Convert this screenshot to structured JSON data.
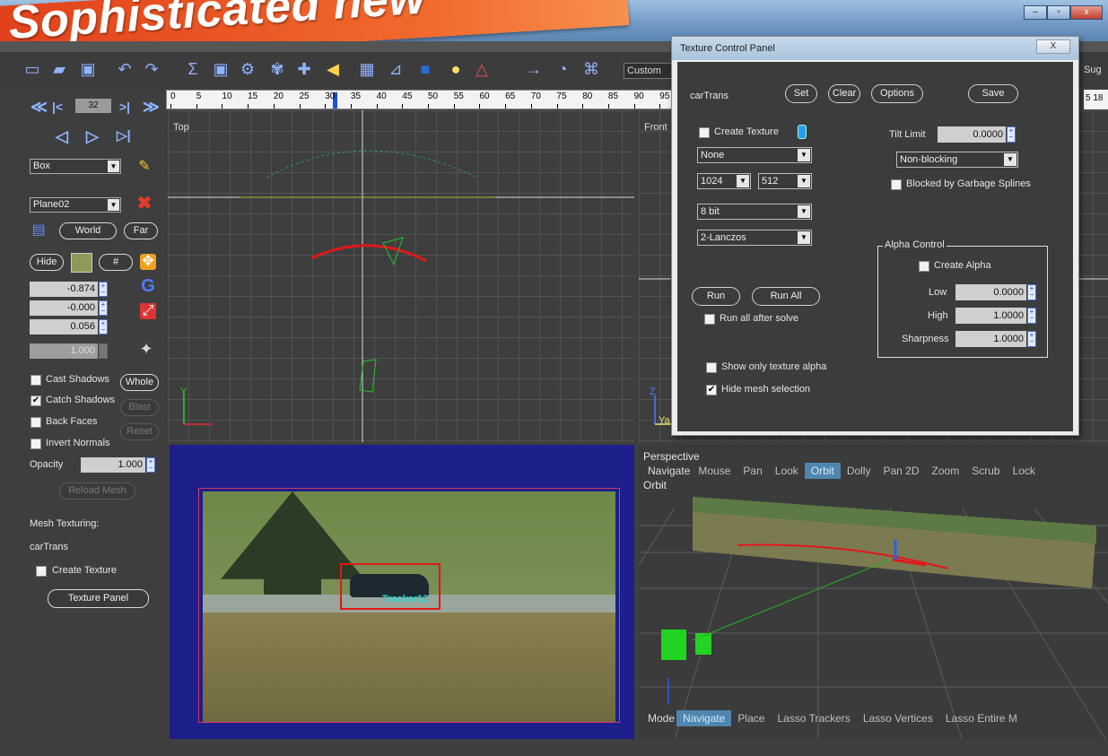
{
  "banner": {
    "text": "Sophisticated new"
  },
  "window": {
    "minimize": "–",
    "maximize": "▫",
    "close": "x"
  },
  "toolbar": {
    "icons": [
      {
        "name": "new-icon",
        "glyph": "▭",
        "color": "#8fb3ff"
      },
      {
        "name": "open-icon",
        "glyph": "▰",
        "color": "#8fb3ff"
      },
      {
        "name": "save-icon",
        "glyph": "▣",
        "color": "#8fb3ff"
      },
      {
        "name": "undo-icon",
        "glyph": "↶",
        "color": "#8fb3ff"
      },
      {
        "name": "redo-icon",
        "glyph": "↷",
        "color": "#8fb3ff"
      },
      {
        "name": "sigma-icon",
        "glyph": "Σ",
        "color": "#8fb3ff"
      },
      {
        "name": "camera-icon",
        "glyph": "▣",
        "color": "#8fb3ff"
      },
      {
        "name": "gear-icon",
        "glyph": "⚙",
        "color": "#8fb3ff"
      },
      {
        "name": "paw-icon",
        "glyph": "✾",
        "color": "#8fb3ff"
      },
      {
        "name": "move-icon",
        "glyph": "✚",
        "color": "#8fb3ff"
      },
      {
        "name": "audio-icon",
        "glyph": "◀",
        "color": "#ffd24a"
      },
      {
        "name": "calculator-icon",
        "glyph": "▦",
        "color": "#8fb3ff"
      },
      {
        "name": "graph-icon",
        "glyph": "⊿",
        "color": "#8fb3ff"
      },
      {
        "name": "cube-icon",
        "glyph": "■",
        "color": "#2a6bd6"
      },
      {
        "name": "light-icon",
        "glyph": "●",
        "color": "#ffe06a"
      },
      {
        "name": "triangle-icon",
        "glyph": "△",
        "color": "#e05050"
      },
      {
        "name": "arrow-right-icon",
        "glyph": "→",
        "color": "#8fb3ff"
      },
      {
        "name": "zoom-clock-icon",
        "glyph": "◔",
        "color": "#8fb3ff"
      },
      {
        "name": "fit-icon",
        "glyph": "⌘",
        "color": "#8fb3ff"
      }
    ],
    "preset": "Custom",
    "sug_label": "Sug"
  },
  "playback": {
    "frame": "32",
    "first": "≪",
    "prev_key": "|<",
    "next_key": ">|",
    "last": "≫",
    "step_back": "◁",
    "play": "▷",
    "step_fwd": "▷|"
  },
  "timeline": {
    "ticks": [
      "0",
      "5",
      "10",
      "15",
      "20",
      "25",
      "30",
      "35",
      "40",
      "45",
      "50",
      "55",
      "60",
      "65",
      "70",
      "75",
      "80",
      "85",
      "90",
      "95"
    ],
    "right_ticks": "5  18"
  },
  "left_panel": {
    "object_type": "Box",
    "object_name": "Plane02",
    "world_btn": "World",
    "far_btn": "Far",
    "hide_btn": "Hide",
    "hash_btn": "#",
    "x_value": "-0.874",
    "y_value": "-0.000",
    "z_value": "0.056",
    "scale_value": "1.000",
    "cast_shadows": "Cast Shadows",
    "catch_shadows": "Catch Shadows",
    "back_faces": "Back Faces",
    "invert_normals": "Invert Normals",
    "whole_btn": "Whole",
    "blast_btn": "Blast",
    "reset_btn": "Reset",
    "opacity_label": "Opacity",
    "opacity_value": "1.000",
    "reload_mesh": "Reload Mesh",
    "mesh_texturing": "Mesh Texturing:",
    "mesh_name": "carTrans",
    "create_texture": "Create Texture",
    "texture_panel": "Texture Panel",
    "check": "✔"
  },
  "viewports": {
    "top": "Top",
    "front": "Front",
    "perspective": "Perspective",
    "orbit": "Orbit",
    "tracker_label": "Tracker12",
    "axis_y": "Y",
    "axis_z": "Z",
    "axis_ya": "Ya"
  },
  "persp_nav": {
    "head": "Navigate",
    "items": [
      "Mouse",
      "Pan",
      "Look",
      "Orbit",
      "Dolly",
      "Pan 2D",
      "Zoom",
      "Scrub",
      "Lock"
    ],
    "active": "Orbit"
  },
  "persp_mode": {
    "head": "Mode",
    "items": [
      "Navigate",
      "Place",
      "Lasso Trackers",
      "Lasso Vertices",
      "Lasso Entire M"
    ],
    "active": "Navigate"
  },
  "dialog": {
    "title": "Texture Control Panel",
    "close": "X",
    "mesh": "carTrans",
    "set": "Set",
    "clear": "Clear",
    "options": "Options",
    "save": "Save",
    "create_texture": "Create Texture",
    "source": "None",
    "width": "1024",
    "height": "512",
    "depth": "8 bit",
    "filter": "2-Lanczos",
    "run": "Run",
    "run_all": "Run All",
    "run_all_after": "Run all after solve",
    "show_only_alpha": "Show only texture alpha",
    "hide_mesh_sel": "Hide mesh selection",
    "tilt_label": "Tilt Limit",
    "tilt_value": "0.0000",
    "blocking": "Non-blocking",
    "blocked_garbage": "Blocked by Garbage Splines",
    "alpha_control": "Alpha Control",
    "create_alpha": "Create Alpha",
    "low_label": "Low",
    "low_value": "0.0000",
    "high_label": "High",
    "high_value": "1.0000",
    "sharp_label": "Sharpness",
    "sharp_value": "1.0000",
    "check": "✔"
  }
}
